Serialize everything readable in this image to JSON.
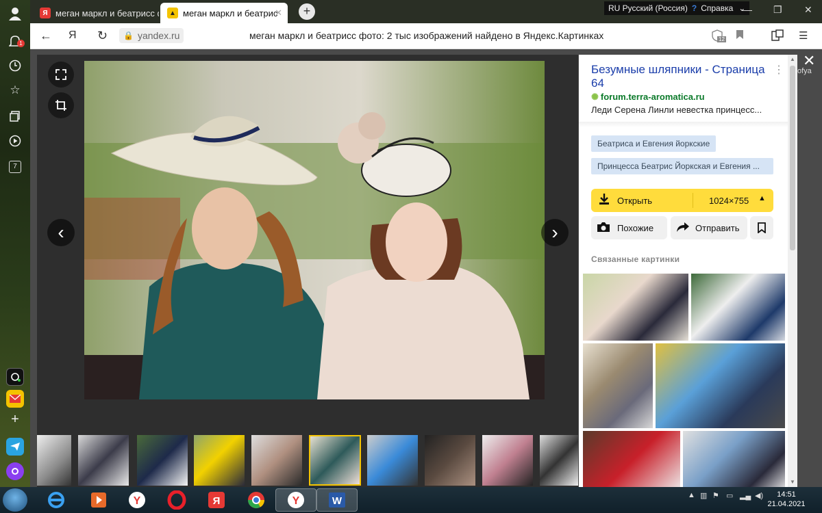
{
  "tabs": [
    {
      "title": "меган маркл и беатрисс ф",
      "state": "inactive"
    },
    {
      "title": "меган маркл и беатрис",
      "state": "active"
    }
  ],
  "system_bar": {
    "language": "RU Русский (Россия)",
    "help": "Справка"
  },
  "address": {
    "url": "yandex.ru",
    "page_title": "меган маркл и беатрисс фото: 2 тыс изображений найдено в Яндекс.Картинках",
    "tab_count": "12"
  },
  "sidebar": {
    "notif_count": "1",
    "counter": "7"
  },
  "panel": {
    "title": "Безумные шляпники - Страница 64",
    "site": "forum.terra-aromatica.ru",
    "description": "Леди Серена Линли невестка принцесс...",
    "tags": [
      "Беатриса и Евгения йоркские",
      "Принцесса Беатрис Йоркская и Евгения ..."
    ],
    "open_label": "Открыть",
    "size": "1024×755",
    "similar_label": "Похожие",
    "share_label": "Отправить",
    "related_header": "Связанные картинки"
  },
  "side_text": "ofya",
  "clock": {
    "time": "14:51",
    "date": "21.04.2021"
  }
}
